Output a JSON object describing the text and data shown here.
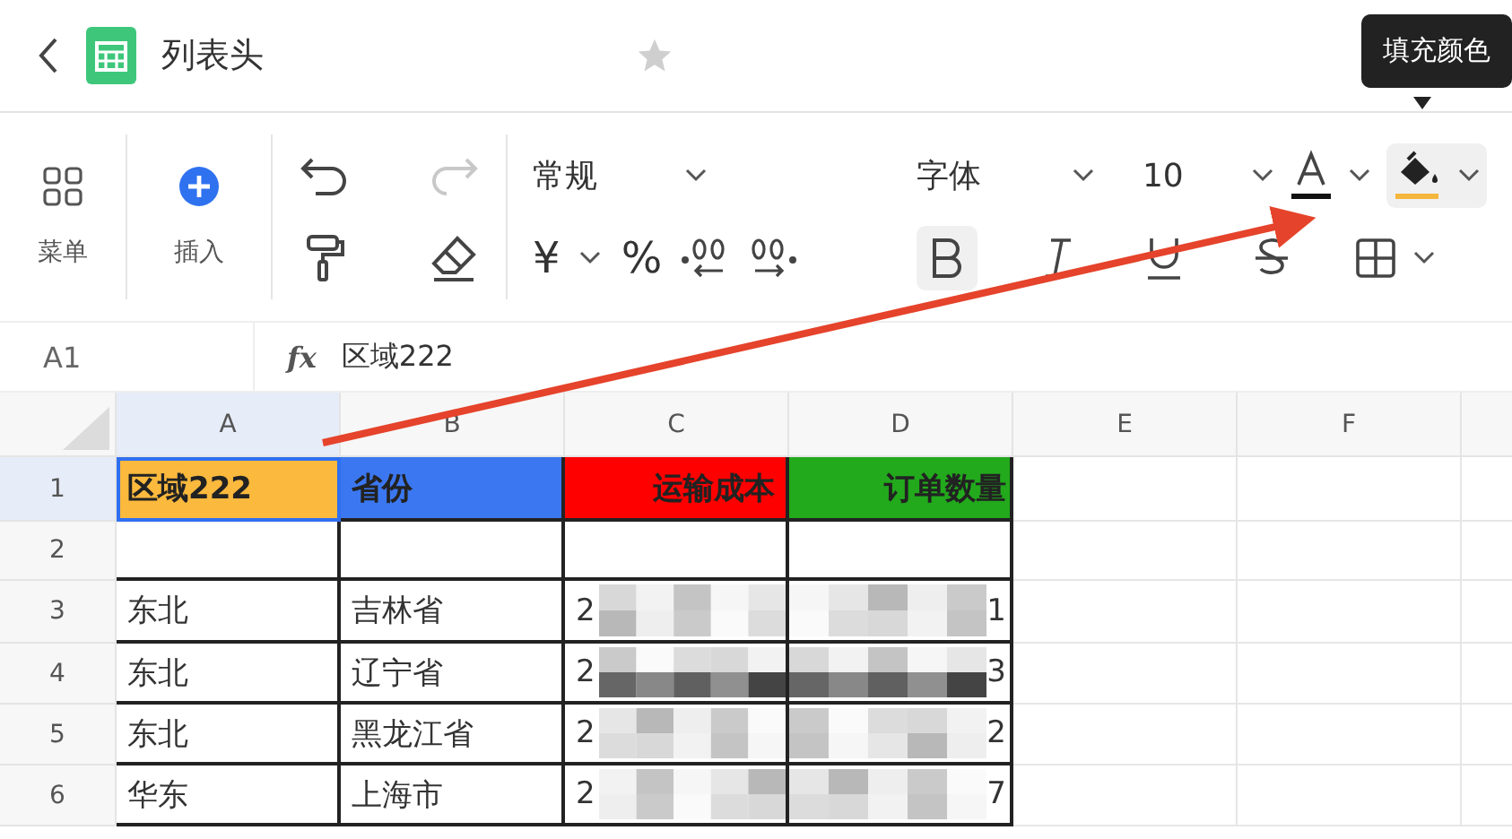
{
  "title_bar": {
    "title": "列表头",
    "starred": false
  },
  "tooltip": {
    "text": "填充颜色"
  },
  "toolbar": {
    "menu_label": "菜单",
    "insert_label": "插入",
    "number_format": "常规",
    "currency_symbol": "¥",
    "percent": "%",
    "font": "字体",
    "font_size": "10",
    "fill_selected": true,
    "bold": true,
    "italic": false,
    "underline": false,
    "strike": false
  },
  "formula_bar": {
    "cell_ref": "A1",
    "fx": "fx",
    "value": "区域222"
  },
  "columns": [
    {
      "label": "A",
      "selected": true
    },
    {
      "label": "B",
      "selected": false
    },
    {
      "label": "C",
      "selected": false
    },
    {
      "label": "D",
      "selected": false
    },
    {
      "label": "E",
      "selected": false
    },
    {
      "label": "F",
      "selected": false
    }
  ],
  "rows": [
    {
      "number": "1",
      "selected": true,
      "cells": [
        {
          "text": "区域222",
          "color": "#fbb93d",
          "bold": true,
          "selected": true,
          "redacted": false
        },
        {
          "text": "省份",
          "color": "#3b77f0",
          "bold": true,
          "selected": false,
          "redacted": false
        },
        {
          "text": "运输成本",
          "color": "#ff0000",
          "bold": true,
          "selected": false,
          "redacted": false
        },
        {
          "text": "订单数量",
          "color": "#22a91c",
          "bold": true,
          "selected": false,
          "redacted": false
        }
      ]
    },
    {
      "number": "2",
      "selected": false,
      "cells": [
        {
          "selected": false,
          "redacted": false
        },
        {
          "selected": false,
          "redacted": false
        },
        {
          "selected": false,
          "redacted": false
        },
        {
          "selected": false,
          "redacted": false
        }
      ]
    },
    {
      "number": "3",
      "selected": false,
      "cells": [
        {
          "text": "东北",
          "bold": false,
          "selected": false,
          "redacted": false
        },
        {
          "text": "吉林省",
          "bold": false,
          "selected": false,
          "redacted": false
        },
        {
          "text": "2",
          "bold": false,
          "selected": false,
          "redacted": true
        },
        {
          "text": "1",
          "bold": false,
          "selected": false,
          "redacted": true
        }
      ]
    },
    {
      "number": "4",
      "selected": false,
      "cells": [
        {
          "text": "东北",
          "bold": false,
          "selected": false,
          "redacted": false
        },
        {
          "text": "辽宁省",
          "bold": false,
          "selected": false,
          "redacted": false
        },
        {
          "text": "2",
          "bold": false,
          "selected": false,
          "redacted": true
        },
        {
          "text": "3",
          "bold": false,
          "selected": false,
          "redacted": true
        }
      ]
    },
    {
      "number": "5",
      "selected": false,
      "cells": [
        {
          "text": "东北",
          "bold": false,
          "selected": false,
          "redacted": false
        },
        {
          "text": "黑龙江省",
          "bold": false,
          "selected": false,
          "redacted": false
        },
        {
          "text": "2",
          "bold": false,
          "selected": false,
          "redacted": true
        },
        {
          "text": "2",
          "bold": false,
          "selected": false,
          "redacted": true
        }
      ]
    },
    {
      "number": "6",
      "selected": false,
      "cells": [
        {
          "text": "华东",
          "bold": false,
          "selected": false,
          "redacted": false
        },
        {
          "text": "上海市",
          "bold": false,
          "selected": false,
          "redacted": false
        },
        {
          "text": "2",
          "bold": false,
          "selected": false,
          "redacted": true
        },
        {
          "text": "7",
          "bold": false,
          "selected": false,
          "redacted": true
        }
      ]
    }
  ]
}
